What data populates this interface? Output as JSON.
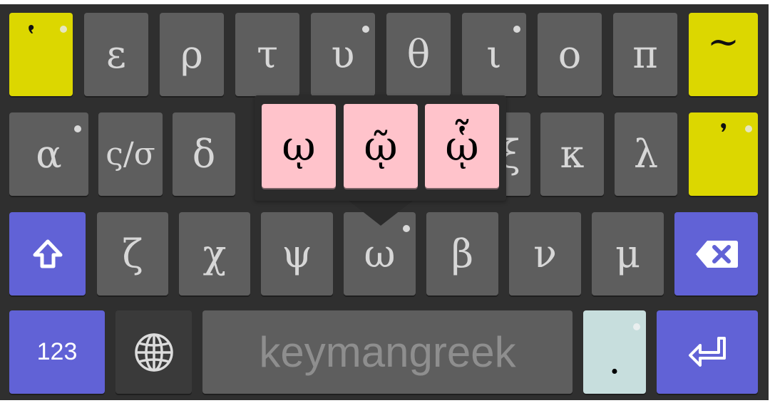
{
  "keyboard": {
    "row1": [
      "῾",
      "ε",
      "ρ",
      "τ",
      "υ",
      "θ",
      "ι",
      "ο",
      "π",
      "~"
    ],
    "row2": [
      "α",
      "ς/σ",
      "δ",
      "ξ",
      "κ",
      "λ",
      "᾽"
    ],
    "row3": {
      "letters": [
        "ζ",
        "χ",
        "ψ",
        "ω",
        "β",
        "ν",
        "μ"
      ],
      "shift_icon": "shift-arrow-icon",
      "backspace_icon": "backspace-icon"
    },
    "row4": {
      "numbers_label": "123",
      "globe_icon": "globe-icon",
      "space_label": "keymangreek",
      "period": ".",
      "enter_icon": "enter-icon"
    },
    "popup": {
      "keys": [
        "ῳ",
        "ῷ",
        "ᾧ"
      ]
    }
  },
  "colors": {
    "background": "#2f2f2f",
    "key": "#5e5e5e",
    "modifier_yellow": "#dcd700",
    "modifier_blue": "#6162d6",
    "popup_key": "#ffc3cb",
    "period_key": "#c7dedd"
  }
}
